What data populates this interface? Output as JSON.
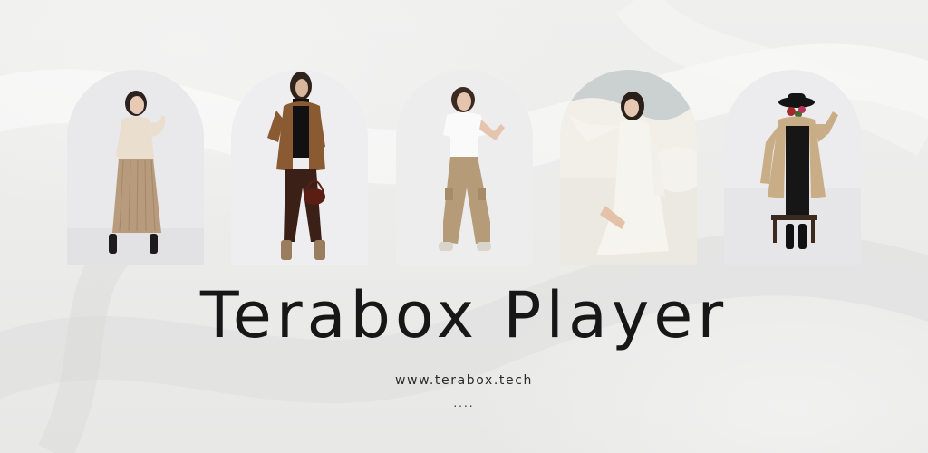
{
  "banner": {
    "title": "Terabox Player",
    "url": "www.terabox.tech",
    "dots": "...."
  },
  "photos": [
    {
      "name": "model-cream-sweater-plaid-skirt"
    },
    {
      "name": "model-brown-jacket-leather-pants"
    },
    {
      "name": "model-white-tee-khaki-cargo"
    },
    {
      "name": "model-white-flowing-dress"
    },
    {
      "name": "mannequin-camel-coat-hat"
    }
  ],
  "colors": {
    "background": "#ececeb",
    "title_text": "#171717"
  }
}
